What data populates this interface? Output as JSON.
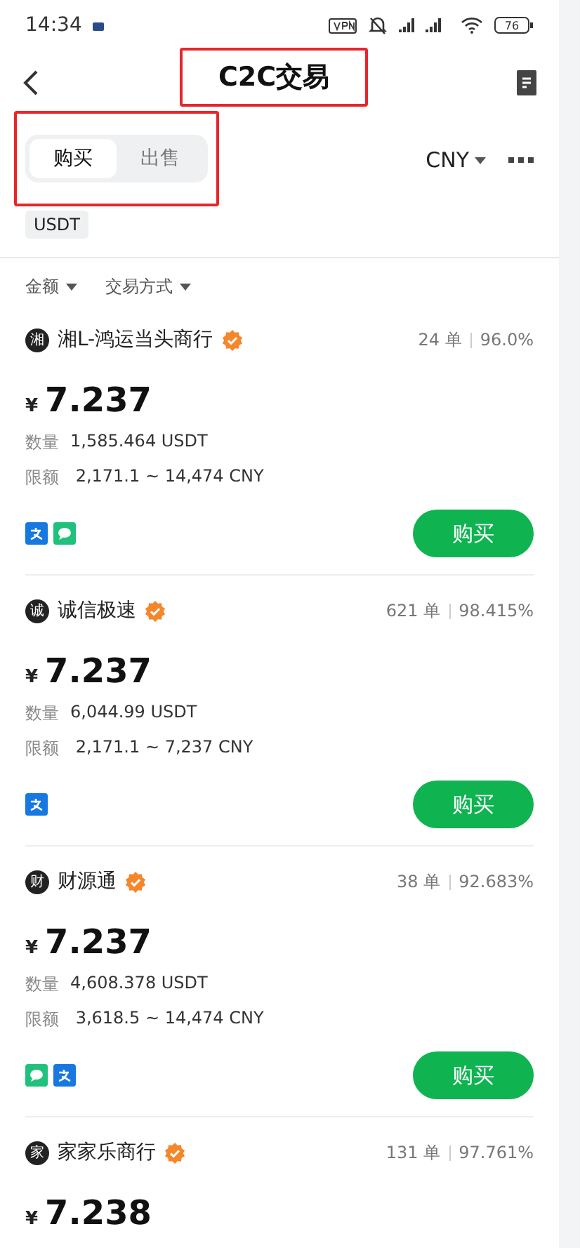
{
  "status_bar": {
    "time": "14:34",
    "battery": "76"
  },
  "header": {
    "title": "C2C交易",
    "title_highlighted": true
  },
  "trade_tabs": {
    "highlighted": true,
    "items": [
      {
        "label": "购买",
        "selected": true
      },
      {
        "label": "出售",
        "selected": false
      }
    ]
  },
  "currency_picker": {
    "label": "CNY"
  },
  "asset_tag": "USDT",
  "filters": [
    {
      "label": "金额"
    },
    {
      "label": "交易方式"
    }
  ],
  "listings": [
    {
      "avatar": "湘",
      "name": "湘L-鸿运当头商行",
      "verified": true,
      "orders": "24 单",
      "completion": "96.0%",
      "currency": "¥",
      "price": "7.237",
      "quantity_label": "数量",
      "quantity": "1,585.464 USDT",
      "limit_label": "限额",
      "limit": "2,171.1 ~ 14,474 CNY",
      "payments": [
        {
          "kind": "alipay"
        },
        {
          "kind": "wechat"
        }
      ],
      "button": "购买"
    },
    {
      "avatar": "诚",
      "name": "诚信极速",
      "verified": true,
      "orders": "621 单",
      "completion": "98.415%",
      "currency": "¥",
      "price": "7.237",
      "quantity_label": "数量",
      "quantity": "6,044.99 USDT",
      "limit_label": "限额",
      "limit": "2,171.1 ~ 7,237 CNY",
      "payments": [
        {
          "kind": "alipay"
        }
      ],
      "button": "购买"
    },
    {
      "avatar": "财",
      "name": "财源通",
      "verified": true,
      "orders": "38 单",
      "completion": "92.683%",
      "currency": "¥",
      "price": "7.237",
      "quantity_label": "数量",
      "quantity": "4,608.378 USDT",
      "limit_label": "限额",
      "limit": "3,618.5 ~ 14,474 CNY",
      "payments": [
        {
          "kind": "wechat"
        },
        {
          "kind": "alipay"
        }
      ],
      "button": "购买"
    },
    {
      "avatar": "家",
      "name": "家家乐商行",
      "verified": true,
      "orders": "131 单",
      "completion": "97.761%",
      "currency": "¥",
      "price": "7.238"
    }
  ]
}
